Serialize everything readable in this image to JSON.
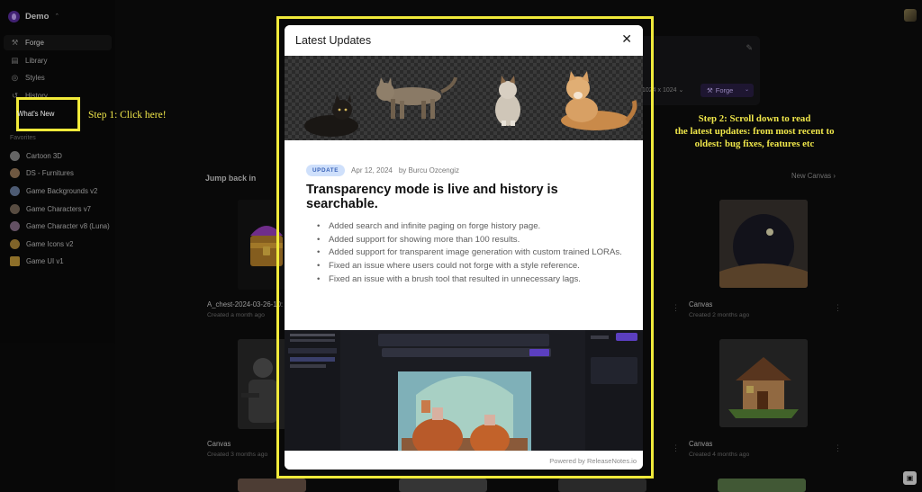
{
  "workspace": {
    "name": "Demo",
    "caret": "⌃"
  },
  "nav": [
    {
      "label": "Forge",
      "icon": "forge-icon",
      "glyph": "⚒"
    },
    {
      "label": "Library",
      "icon": "library-icon",
      "glyph": "▤"
    },
    {
      "label": "Styles",
      "icon": "styles-icon",
      "glyph": "◎"
    },
    {
      "label": "History",
      "icon": "history-icon",
      "glyph": "↺"
    },
    {
      "label": "What's New",
      "icon": "gift-icon",
      "glyph": "✦"
    }
  ],
  "favorites": {
    "title": "Favorites",
    "items": [
      {
        "label": "Cartoon 3D",
        "color": "#8c8c8c"
      },
      {
        "label": "DS - Furnitures",
        "color": "#9a7b5a"
      },
      {
        "label": "Game Backgrounds v2",
        "color": "#6b7fa0"
      },
      {
        "label": "Game Characters v7",
        "color": "#7a6a5a"
      },
      {
        "label": "Game Character v8 (Luna)",
        "color": "#8a6f8a"
      },
      {
        "label": "Game Icons v2",
        "color": "#b0893a"
      },
      {
        "label": "Game UI v1",
        "color": "#c49a3a"
      }
    ]
  },
  "annotations": {
    "step1": "Step 1: Click here!",
    "step2_lines": [
      "Step 2: Scroll down to read",
      "the latest updates: from most recent to",
      "oldest: bug fixes, features etc"
    ]
  },
  "prompt_panel": {
    "size": "1024 x 1024",
    "forge_label": "Forge"
  },
  "main": {
    "jump_back_in": "Jump back in",
    "new_canvas": "New Canvas",
    "cards": [
      {
        "title": "A_chest-2024-03-26-10:",
        "sub": "Created a month ago"
      },
      {
        "title": "Canvas",
        "sub": "Created 2 months ago"
      },
      {
        "title": "Canvas",
        "sub": "Created 3 months ago"
      },
      {
        "title": "Canvas",
        "sub": "Created 4 months ago"
      }
    ]
  },
  "modal": {
    "title": "Latest Updates",
    "close": "✕",
    "post": {
      "badge": "UPDATE",
      "date": "Apr 12, 2024",
      "author": "by Burcu Ozcengiz",
      "title": "Transparency mode is live and history is searchable.",
      "items": [
        "Added search and infinite paging on forge history page.",
        "Added support for showing more than 100 results.",
        "Added support for transparent image generation with custom trained LORAs.",
        "Fixed an issue where users could not forge with a style reference.",
        "Fixed an issue with a brush tool that resulted in unnecessary lags."
      ]
    },
    "footer": "Powered by ReleaseNotes.io"
  },
  "colors": {
    "accent": "#f1ea3a",
    "brand": "#5b2fa0",
    "badge_bg": "#cfe0fb",
    "badge_text": "#3a63b8"
  }
}
